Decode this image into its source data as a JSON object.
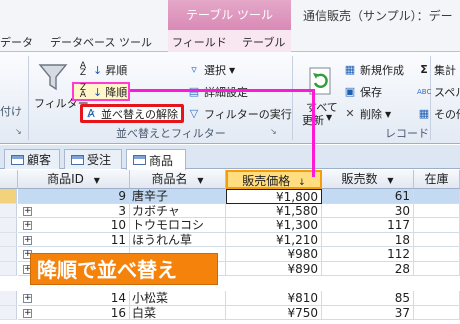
{
  "title_bar": {
    "context_tab_header": "テーブル ツール",
    "window_title": "通信販売（サンプル）：デー"
  },
  "ribbon_tabs": {
    "tabs": [
      "データ",
      "データベース ツール",
      "フィールド",
      "テーブル"
    ]
  },
  "ribbon": {
    "left_cut_label": "付け",
    "filter": "フィルター",
    "ascending": "昇順",
    "descending": "降順",
    "remove_sort": "並べ替えの解除",
    "selection": "選択",
    "advanced": "詳細設定",
    "toggle_filter": "フィルターの実行",
    "group_sort_filter": "並べ替えとフィルター",
    "refresh_line1": "すべて",
    "refresh_line2": "更新",
    "new": "新規作成",
    "save": "保存",
    "delete": "削除",
    "group_records": "レコード",
    "totals": "集計",
    "spelling": "スペル",
    "more": "その他"
  },
  "object_tabs": [
    "顧客",
    "受注",
    "商品"
  ],
  "datasheet": {
    "columns": [
      "商品ID",
      "商品名",
      "販売価格",
      "販売数",
      "在庫"
    ],
    "rows": [
      {
        "id": "9",
        "name": "唐辛子",
        "price": "¥1,800",
        "sold": "61"
      },
      {
        "id": "3",
        "name": "カボチャ",
        "price": "¥1,580",
        "sold": "30"
      },
      {
        "id": "10",
        "name": "トウモロコシ",
        "price": "¥1,300",
        "sold": "117"
      },
      {
        "id": "11",
        "name": "ほうれん草",
        "price": "¥1,210",
        "sold": "18"
      },
      {
        "id": "",
        "name": "",
        "price": "¥980",
        "sold": "112"
      },
      {
        "id": "",
        "name": "",
        "price": "¥890",
        "sold": "28"
      },
      {
        "id": "14",
        "name": "小松菜",
        "price": "¥810",
        "sold": "85"
      },
      {
        "id": "16",
        "name": "白菜",
        "price": "¥750",
        "sold": "37"
      }
    ]
  },
  "callout": "降順で並べ替え",
  "colors": {
    "accent_pink": "#ff18d7",
    "highlight_red": "#e4151b",
    "callout_orange": "#f5820a",
    "sorted_header": "#ffdd80"
  }
}
